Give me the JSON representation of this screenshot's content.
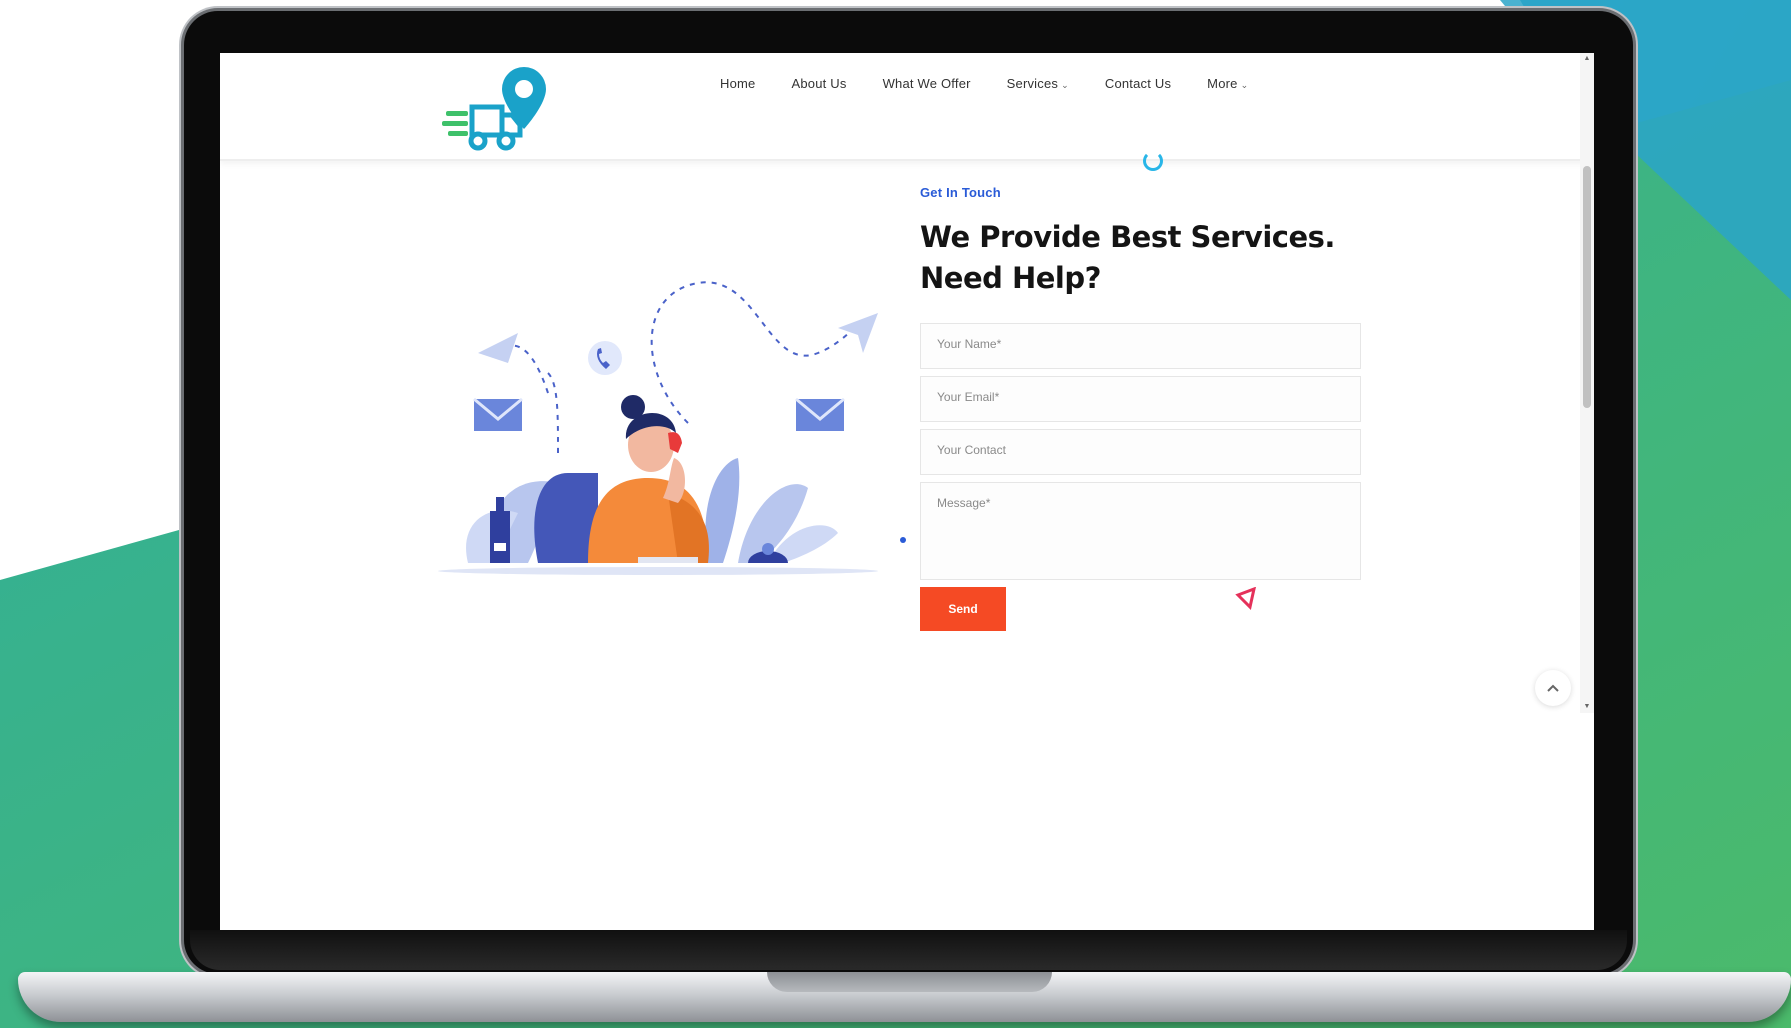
{
  "nav": {
    "items": [
      {
        "label": "Home",
        "has_dropdown": false
      },
      {
        "label": "About Us",
        "has_dropdown": false
      },
      {
        "label": "What We Offer",
        "has_dropdown": false
      },
      {
        "label": "Services",
        "has_dropdown": true
      },
      {
        "label": "Contact Us",
        "has_dropdown": false
      },
      {
        "label": "More",
        "has_dropdown": true
      }
    ],
    "caret": "⌄"
  },
  "contact": {
    "eyebrow": "Get In Touch",
    "headline": "We Provide Best Services. Need Help?",
    "form": {
      "name_placeholder": "Your Name*",
      "email_placeholder": "Your Email*",
      "contact_placeholder": "Your Contact",
      "message_placeholder": "Message*",
      "send_label": "Send"
    }
  },
  "colors": {
    "accent_blue": "#2a5bd7",
    "send_button": "#f54a24",
    "logo_teal": "#1aa2c9",
    "logo_green": "#3ec16a",
    "bg_teal": "#2fb1b4",
    "bg_green": "#47b86c"
  },
  "icons": {
    "logo": "delivery-truck-location-logo",
    "back_to_top": "chevron-up-icon",
    "loader": "loading-ring-icon"
  }
}
